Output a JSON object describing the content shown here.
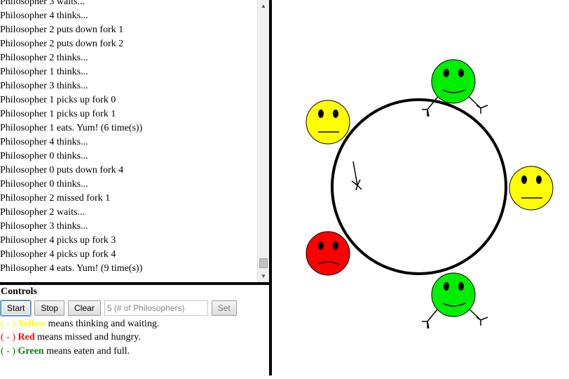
{
  "log": {
    "lines": [
      "Philosopher 3 waits...",
      "Philosopher 4 thinks...",
      "Philosopher 2 puts down fork 1",
      "Philosopher 2 puts down fork 2",
      "Philosopher 2 thinks...",
      "Philosopher 1 thinks...",
      "Philosopher 3 thinks...",
      "Philosopher 1 picks up fork 0",
      "Philosopher 1 picks up fork 1",
      "Philosopher 1 eats. Yum! (6 time(s))",
      "Philosopher 4 thinks...",
      "Philosopher 0 thinks...",
      "Philosopher 0 puts down fork 4",
      "Philosopher 0 thinks...",
      "Philosopher 2 missed fork 1",
      "Philosopher 2 waits...",
      "Philosopher 3 thinks...",
      "Philosopher 4 picks up fork 3",
      "Philosopher 4 picks up fork 4",
      "Philosopher 4 eats. Yum! (9 time(s))"
    ],
    "scroll_up_icon": "▲",
    "scroll_down_icon": "▼"
  },
  "controls": {
    "title": "Controls",
    "start_label": "Start",
    "stop_label": "Stop",
    "clear_label": "Clear",
    "input_value": "5 (# of Philosophers)",
    "set_label": "Set"
  },
  "legend": [
    {
      "prefix": "( - )",
      "color_word": "Yellow",
      "rest": "means thinking and waiting.",
      "color": "#ffff00"
    },
    {
      "prefix": "( - )",
      "color_word": "Red",
      "rest": "means missed and hungry.",
      "color": "#ff0000"
    },
    {
      "prefix": "( - )",
      "color_word": "Green",
      "rest": "means eaten and full.",
      "color": "#008000"
    }
  ],
  "colors": {
    "yellow": "#ffff00",
    "red": "#ff0000",
    "green": "#00ee00",
    "outline": "#000000"
  },
  "philosophers": [
    {
      "name": "philosopher-top-right",
      "state": "green"
    },
    {
      "name": "philosopher-right",
      "state": "yellow"
    },
    {
      "name": "philosopher-bottom",
      "state": "green"
    },
    {
      "name": "philosopher-left-bottom",
      "state": "red"
    },
    {
      "name": "philosopher-left-top",
      "state": "yellow"
    }
  ]
}
